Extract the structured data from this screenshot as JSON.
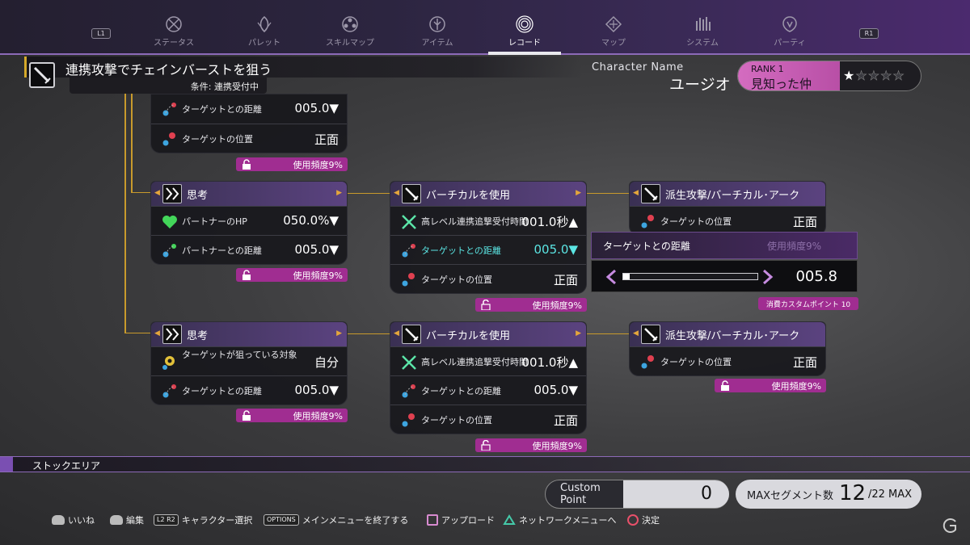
{
  "nav": {
    "l_button": "L1",
    "r_button": "R1",
    "tabs": [
      {
        "label": "ステータス",
        "icon": "status-icon"
      },
      {
        "label": "パレット",
        "icon": "palette-icon"
      },
      {
        "label": "スキルマップ",
        "icon": "skillmap-icon"
      },
      {
        "label": "アイテム",
        "icon": "item-icon"
      },
      {
        "label": "レコード",
        "icon": "record-icon",
        "active": true
      },
      {
        "label": "マップ",
        "icon": "map-icon"
      },
      {
        "label": "システム",
        "icon": "system-icon"
      },
      {
        "label": "パーティ",
        "icon": "party-icon"
      }
    ]
  },
  "header": {
    "title": "連携攻撃でチェインバーストを狙う",
    "condition": "条件: 連携受付中",
    "character_label": "Character Name",
    "character_name": "ユージオ",
    "rank_label": "RANK 1",
    "rank_name": "見知った仲",
    "stars_filled": 1,
    "stars_total": 5
  },
  "nodes": {
    "n1": {
      "rows": [
        {
          "label": "ターゲットとの距離",
          "value": "005.0▼"
        },
        {
          "label": "ターゲットの位置",
          "value": "正面"
        }
      ],
      "freq": "使用頻度9%"
    },
    "n2": {
      "title": "思考",
      "rows": [
        {
          "label": "パートナーのHP",
          "value": "050.0%▼"
        },
        {
          "label": "パートナーとの距離",
          "value": "005.0▼"
        }
      ],
      "freq": "使用頻度9%"
    },
    "n3": {
      "title": "バーチカルを使用",
      "rows": [
        {
          "label": "高レベル連携追撃受付時間",
          "value": "001.0秒▲"
        },
        {
          "label": "ターゲットとの距離",
          "value": "005.0▼"
        },
        {
          "label": "ターゲットの位置",
          "value": "正面"
        }
      ],
      "freq": "使用頻度9%"
    },
    "n4": {
      "title": "派生攻撃/バーチカル･アーク",
      "rows": [
        {
          "label": "ターゲットの位置",
          "value": "正面"
        }
      ]
    },
    "n5": {
      "title": "思考",
      "rows": [
        {
          "label": "ターゲットが狙っている対象",
          "value": "自分"
        },
        {
          "label": "ターゲットとの距離",
          "value": "005.0▼"
        }
      ],
      "freq": "使用頻度9%"
    },
    "n6": {
      "title": "バーチカルを使用",
      "rows": [
        {
          "label": "高レベル連携追撃受付時間",
          "value": "001.0秒▲"
        },
        {
          "label": "ターゲットとの距離",
          "value": "005.0▼"
        },
        {
          "label": "ターゲットの位置",
          "value": "正面"
        }
      ],
      "freq": "使用頻度9%"
    },
    "n7": {
      "title": "派生攻撃/バーチカル･アーク",
      "rows": [
        {
          "label": "ターゲットの位置",
          "value": "正面"
        }
      ],
      "freq": "使用頻度9%"
    }
  },
  "editor": {
    "label": "ターゲットとの距離",
    "freq": "使用頻度9%",
    "value": "005.8",
    "slider_fraction": 0.05,
    "cost": "消費カスタムポイント  10"
  },
  "stock": {
    "label": "ストックエリア"
  },
  "footer": {
    "custom_point_l1": "Custom",
    "custom_point_l2": "Point",
    "custom_point_value": "0",
    "max_segment_label": "MAXセグメント数",
    "max_segment_value": "12",
    "max_segment_max": "/22 MAX"
  },
  "controls": [
    {
      "key": "L3",
      "label": "いいね"
    },
    {
      "key": "R3",
      "label": "編集"
    },
    {
      "key": "L2 R2",
      "label": "キャラクター選択"
    },
    {
      "key": "OPTIONS",
      "label": "メインメニューを終了する"
    },
    {
      "key": "square",
      "label": "アップロード"
    },
    {
      "key": "triangle",
      "label": "ネットワークメニューへ"
    },
    {
      "key": "circle",
      "label": "決定"
    }
  ],
  "colors": {
    "accent_purple": "#7a4fb2",
    "freq_magenta": "#a02d91",
    "flow_line": "#c89a2c",
    "highlight_cyan": "#5be5e3"
  }
}
